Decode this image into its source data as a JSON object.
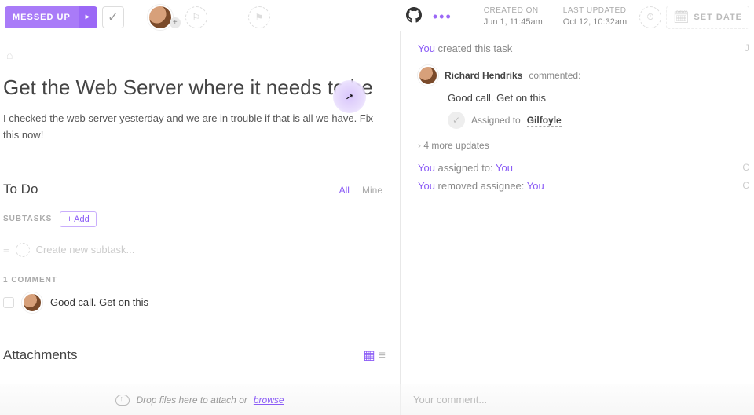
{
  "toolbar": {
    "status": "MESSED UP",
    "created_label": "CREATED ON",
    "created_value": "Jun 1, 11:45am",
    "updated_label": "LAST UPDATED",
    "updated_value": "Oct 12, 10:32am",
    "setdate": "SET DATE"
  },
  "task": {
    "title": "Get the Web Server where it needs to be",
    "description": "I checked the web server yesterday and we are in trouble if that is all we have. Fix this now!"
  },
  "todo": {
    "title": "To Do",
    "tab_all": "All",
    "tab_mine": "Mine",
    "subtasks_label": "SUBTASKS",
    "add_label": "+ Add",
    "new_placeholder": "Create new subtask..."
  },
  "comments": {
    "count_label": "1 COMMENT",
    "items": [
      {
        "text": "Good call. Get on this"
      }
    ]
  },
  "attachments": {
    "title": "Attachments"
  },
  "activity": {
    "created": {
      "who": "You",
      "text": " created this task"
    },
    "comment": {
      "author": "Richard Hendriks",
      "verb": " commented:",
      "body": "Good call. Get on this",
      "assigned_label": "Assigned to ",
      "assigned_to": "Gilfoyle"
    },
    "more": "4 more updates",
    "rows": [
      {
        "who": "You",
        "mid": " assigned to: ",
        "target": "You"
      },
      {
        "who": "You",
        "mid": " removed assignee: ",
        "target": "You"
      }
    ]
  },
  "footer": {
    "drop_text": "Drop files here to attach or ",
    "browse": "browse",
    "comment_placeholder": "Your comment..."
  }
}
